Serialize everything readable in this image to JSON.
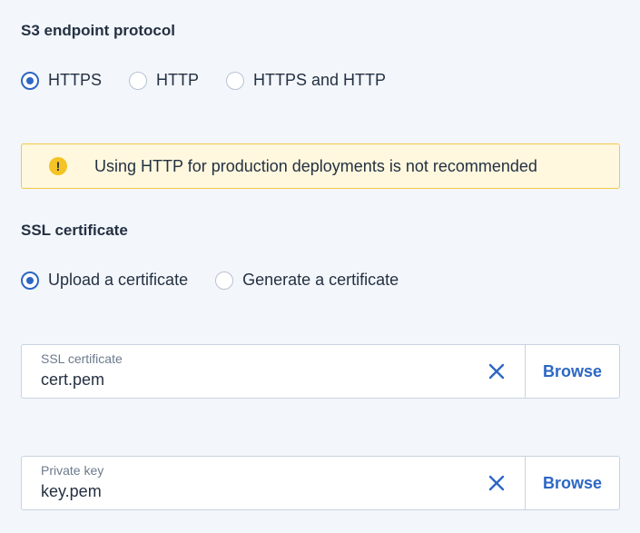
{
  "protocol": {
    "title": "S3 endpoint protocol",
    "options": [
      {
        "label": "HTTPS",
        "checked": true
      },
      {
        "label": "HTTP",
        "checked": false
      },
      {
        "label": "HTTPS and HTTP",
        "checked": false
      }
    ]
  },
  "warning": {
    "icon": "exclamation-icon",
    "text": "Using HTTP for production deployments is not recommended"
  },
  "ssl": {
    "title": "SSL certificate",
    "options": [
      {
        "label": "Upload a certificate",
        "checked": true
      },
      {
        "label": "Generate a certificate",
        "checked": false
      }
    ]
  },
  "cert_field": {
    "label": "SSL certificate",
    "value": "cert.pem",
    "browse_label": "Browse"
  },
  "key_field": {
    "label": "Private key",
    "value": "key.pem",
    "browse_label": "Browse"
  },
  "colors": {
    "accent": "#2d67c4",
    "warning_bg": "#fff8de",
    "warning_border": "#f2c84b",
    "background": "#f3f6fb"
  }
}
